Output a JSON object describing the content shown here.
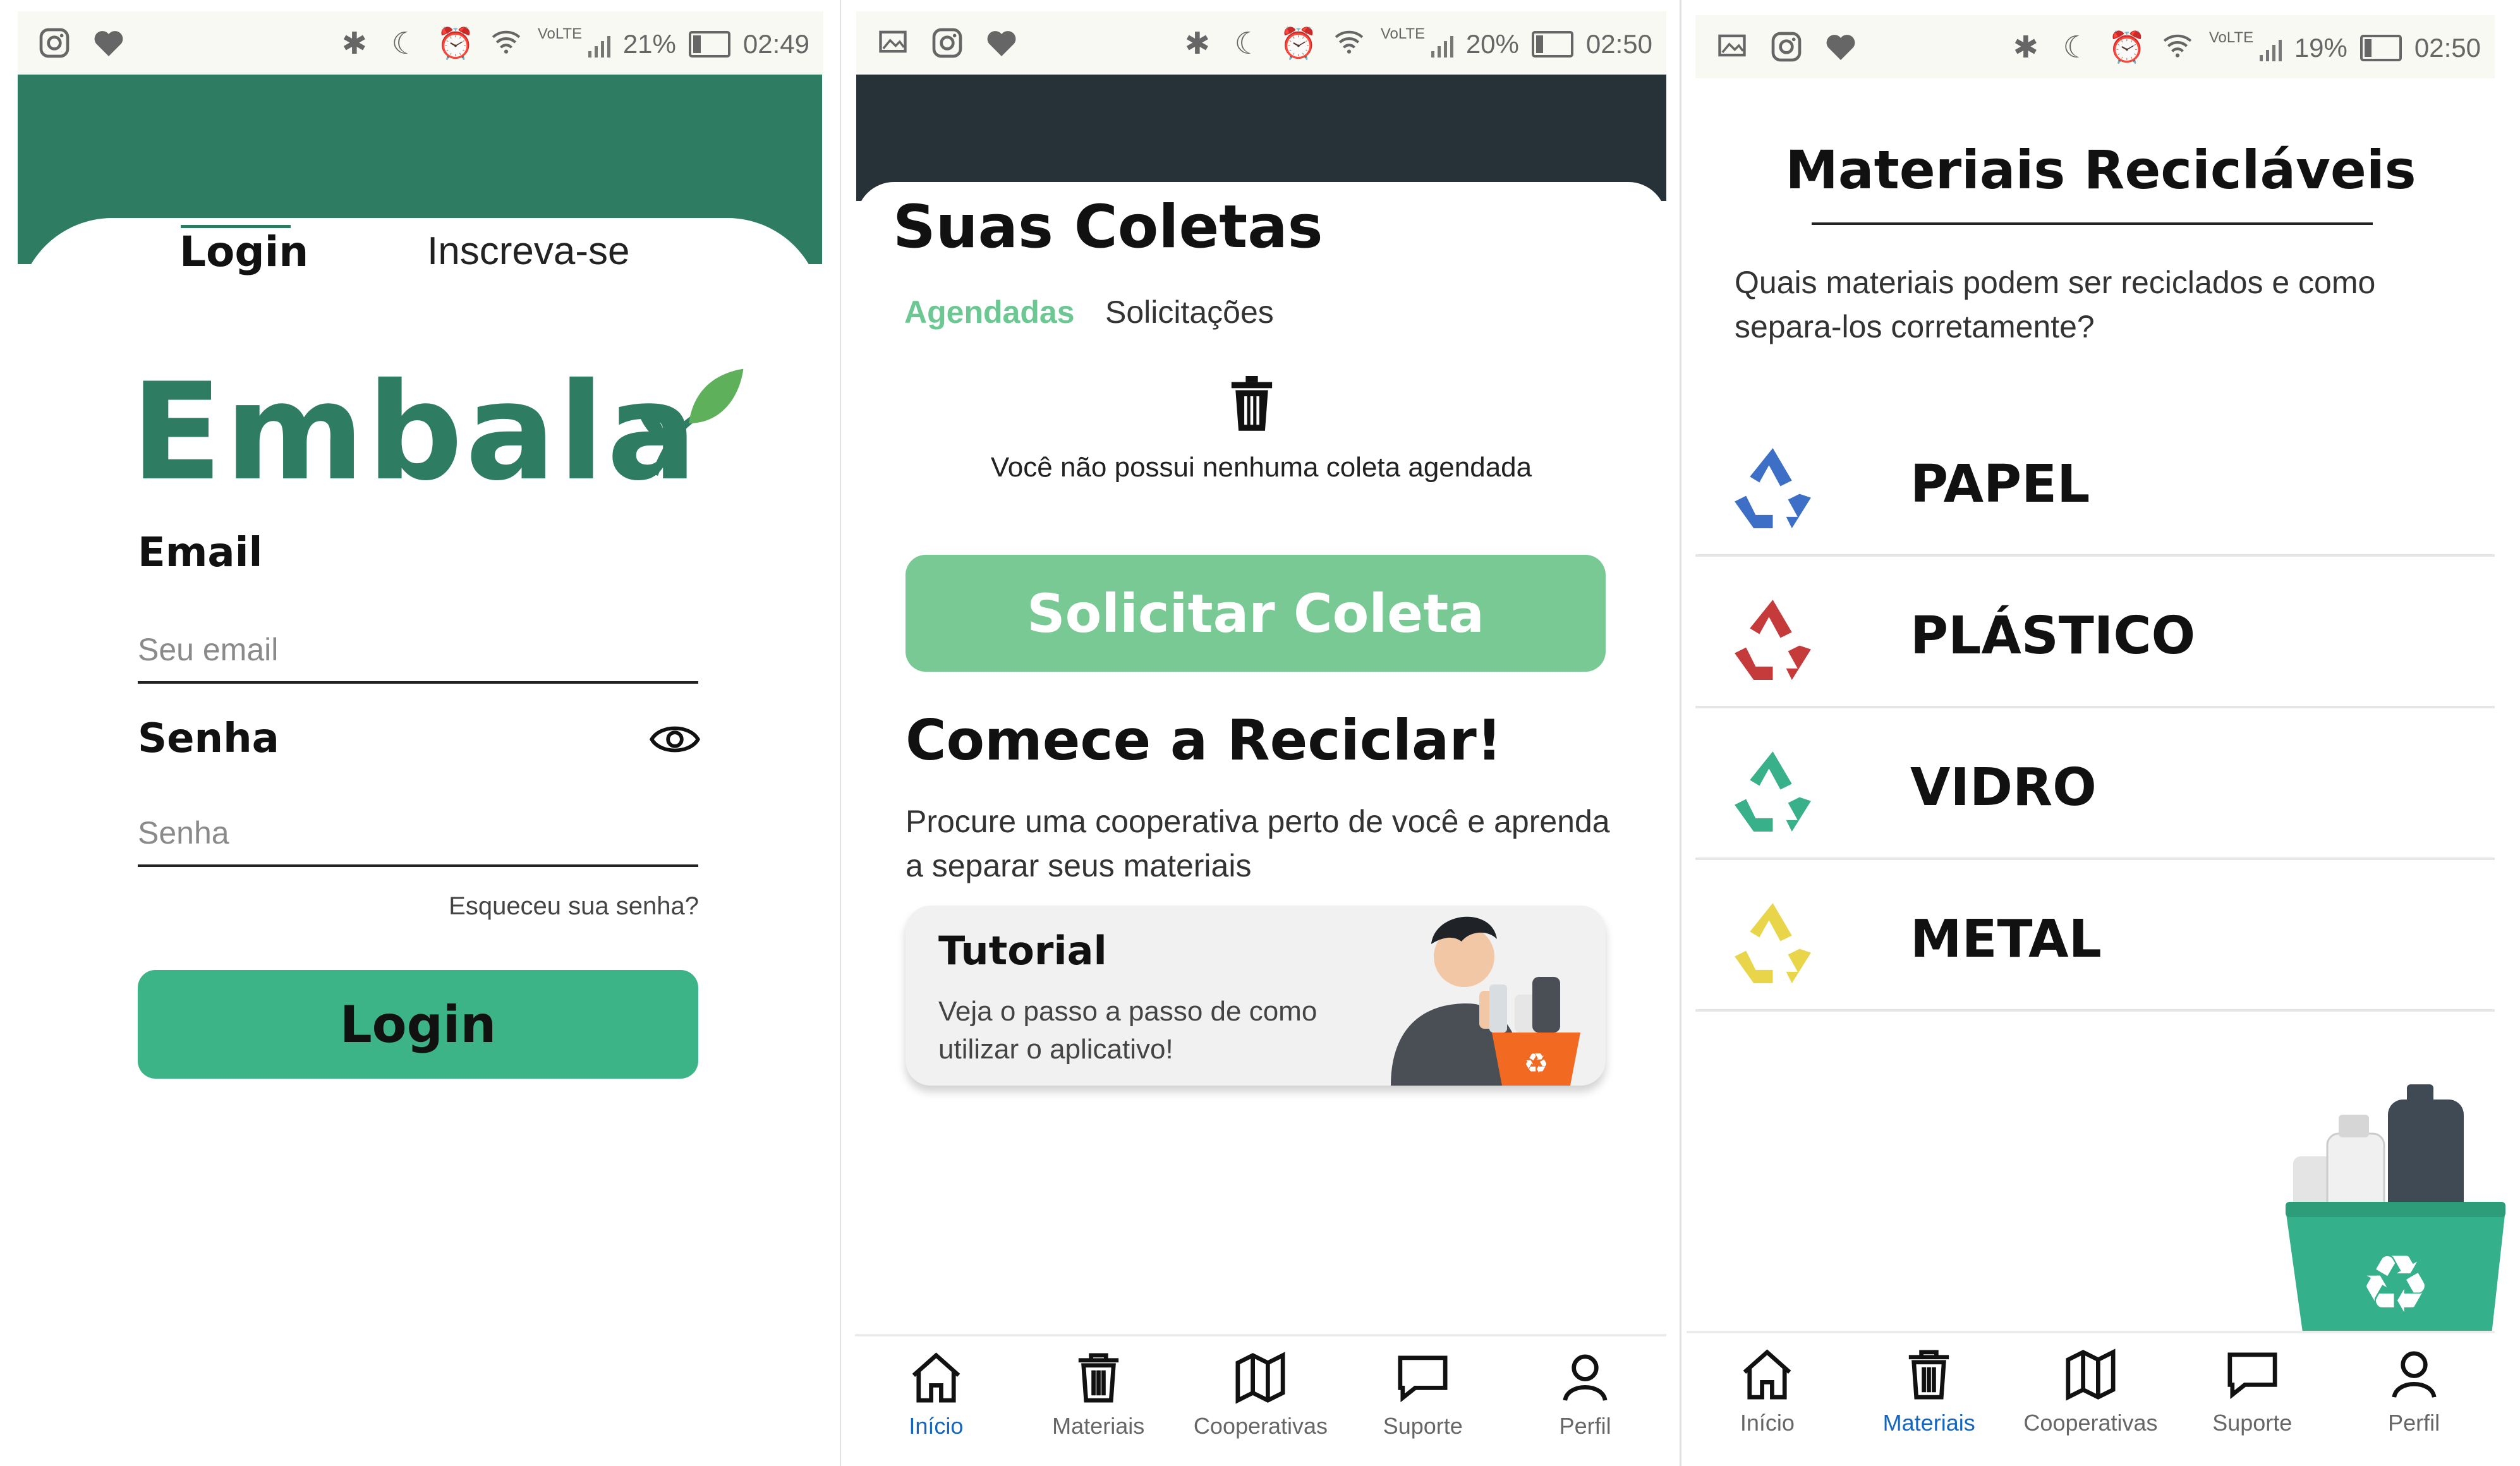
{
  "screens": {
    "login": {
      "status": {
        "battery": "21%",
        "time": "02:49",
        "battery_level": 0.21
      },
      "tabs": {
        "login": "Login",
        "register": "Inscreva-se"
      },
      "logo": "Embala",
      "email": {
        "label": "Email",
        "placeholder": "Seu email"
      },
      "password": {
        "label": "Senha",
        "placeholder": "Senha"
      },
      "forgot": "Esqueceu sua senha?",
      "login_button": "Login"
    },
    "collections": {
      "status": {
        "battery": "20%",
        "time": "02:50",
        "battery_level": 0.2
      },
      "title": "Suas Coletas",
      "tabs": {
        "scheduled": "Agendadas",
        "requests": "Solicitações"
      },
      "empty_message": "Você não possui nenhuma coleta agendada",
      "request_button": "Solicitar Coleta",
      "recycle_heading": "Comece a Reciclar!",
      "recycle_desc": "Procure uma cooperativa perto de você e aprenda a separar seus materiais",
      "tutorial": {
        "title": "Tutorial",
        "desc": "Veja o passo a passo de como utilizar o aplicativo!"
      }
    },
    "materials": {
      "status": {
        "battery": "19%",
        "time": "02:50",
        "battery_level": 0.19
      },
      "title": "Materiais Recicláveis",
      "desc": "Quais materiais podem ser reciclados e como separa-los corretamente?",
      "items": [
        {
          "label": "PAPEL",
          "icon": "recycle-icon",
          "color": "#3e6fc6"
        },
        {
          "label": "PLÁSTICO",
          "icon": "recycle-icon",
          "color": "#c53a3a"
        },
        {
          "label": "VIDRO",
          "icon": "recycle-icon",
          "color": "#38b08a"
        },
        {
          "label": "METAL",
          "icon": "recycle-icon",
          "color": "#e8d54a"
        }
      ]
    }
  },
  "nav": {
    "items": [
      {
        "label": "Início",
        "icon": "home-icon"
      },
      {
        "label": "Materiais",
        "icon": "trash-icon"
      },
      {
        "label": "Cooperativas",
        "icon": "map-icon"
      },
      {
        "label": "Suporte",
        "icon": "chat-icon"
      },
      {
        "label": "Perfil",
        "icon": "user-icon"
      }
    ],
    "active_color": "#1565c0"
  },
  "colors": {
    "brand_green": "#2e7d62",
    "button_green": "#3db488",
    "light_green": "#78c993",
    "dark_header": "#263238"
  }
}
